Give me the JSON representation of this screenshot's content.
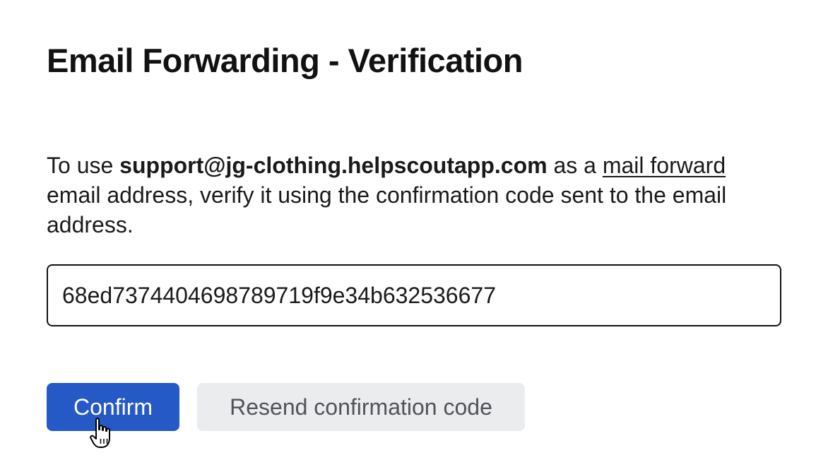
{
  "page": {
    "title": "Email Forwarding - Verification"
  },
  "description": {
    "prefix": "To use ",
    "email": "support@jg-clothing.helpscoutapp.com",
    "middle": " as a ",
    "link_text": "mail forward",
    "suffix": " email address, verify it using the confirmation code sent to the email address."
  },
  "form": {
    "code_value": "68ed7374404698789719f9e34b632536677"
  },
  "actions": {
    "confirm_label": "Confirm",
    "resend_label": "Resend confirmation code"
  },
  "colors": {
    "primary": "#2559c6",
    "secondary_bg": "#ebecee",
    "secondary_text": "#505459"
  },
  "icons": {
    "cursor": "hand-pointer-icon"
  }
}
